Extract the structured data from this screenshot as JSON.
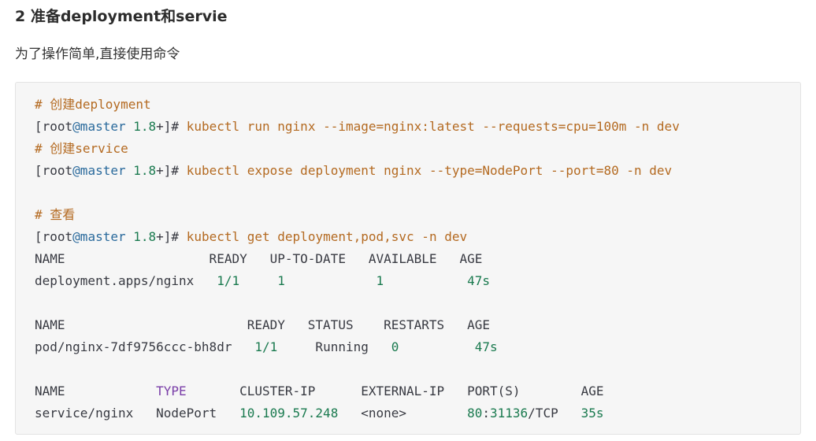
{
  "heading": "2 准备deployment和servie",
  "intro": "为了操作简单,直接使用命令",
  "code": {
    "lines": [
      [
        {
          "t": "# 创建deployment",
          "c": "comment"
        }
      ],
      [
        {
          "t": "[root",
          "c": "plain"
        },
        {
          "t": "@master",
          "c": "host"
        },
        {
          "t": " ",
          "c": "plain"
        },
        {
          "t": "1.8",
          "c": "num"
        },
        {
          "t": "+]# ",
          "c": "plain"
        },
        {
          "t": "kubectl run nginx --image=nginx:latest --requests=cpu=100m -n dev",
          "c": "cmd"
        }
      ],
      [
        {
          "t": "# 创建service",
          "c": "comment"
        }
      ],
      [
        {
          "t": "[root",
          "c": "plain"
        },
        {
          "t": "@master",
          "c": "host"
        },
        {
          "t": " ",
          "c": "plain"
        },
        {
          "t": "1.8",
          "c": "num"
        },
        {
          "t": "+]# ",
          "c": "plain"
        },
        {
          "t": "kubectl expose deployment nginx --type=NodePort --port=80 -n dev",
          "c": "cmd"
        }
      ],
      [],
      [
        {
          "t": "# 查看",
          "c": "comment"
        }
      ],
      [
        {
          "t": "[root",
          "c": "plain"
        },
        {
          "t": "@master",
          "c": "host"
        },
        {
          "t": " ",
          "c": "plain"
        },
        {
          "t": "1.8",
          "c": "num"
        },
        {
          "t": "+]# ",
          "c": "plain"
        },
        {
          "t": "kubectl get deployment,pod,svc -n dev",
          "c": "cmd"
        }
      ],
      [
        {
          "t": "NAME                   READY   UP-TO-DATE   AVAILABLE   AGE",
          "c": "plain"
        }
      ],
      [
        {
          "t": "deployment.apps/nginx   ",
          "c": "plain"
        },
        {
          "t": "1/1",
          "c": "num"
        },
        {
          "t": "     ",
          "c": "plain"
        },
        {
          "t": "1",
          "c": "num"
        },
        {
          "t": "            ",
          "c": "plain"
        },
        {
          "t": "1",
          "c": "num"
        },
        {
          "t": "           ",
          "c": "plain"
        },
        {
          "t": "47s",
          "c": "num"
        }
      ],
      [],
      [
        {
          "t": "NAME                        READY   STATUS    RESTARTS   AGE",
          "c": "plain"
        }
      ],
      [
        {
          "t": "pod/nginx-7df9756ccc-bh8dr   ",
          "c": "plain"
        },
        {
          "t": "1/1",
          "c": "num"
        },
        {
          "t": "     Running   ",
          "c": "plain"
        },
        {
          "t": "0",
          "c": "num"
        },
        {
          "t": "          ",
          "c": "plain"
        },
        {
          "t": "47s",
          "c": "num"
        }
      ],
      [],
      [
        {
          "t": "NAME            ",
          "c": "plain"
        },
        {
          "t": "TYPE",
          "c": "kw"
        },
        {
          "t": "       CLUSTER-IP      EXTERNAL-IP   PORT(S)        AGE",
          "c": "plain"
        }
      ],
      [
        {
          "t": "service/nginx   NodePort   ",
          "c": "plain"
        },
        {
          "t": "10.109.57.248",
          "c": "num"
        },
        {
          "t": "   <none>        ",
          "c": "plain"
        },
        {
          "t": "80",
          "c": "num"
        },
        {
          "t": ":",
          "c": "plain"
        },
        {
          "t": "31136",
          "c": "num"
        },
        {
          "t": "/TCP   ",
          "c": "plain"
        },
        {
          "t": "35s",
          "c": "num"
        }
      ]
    ]
  }
}
